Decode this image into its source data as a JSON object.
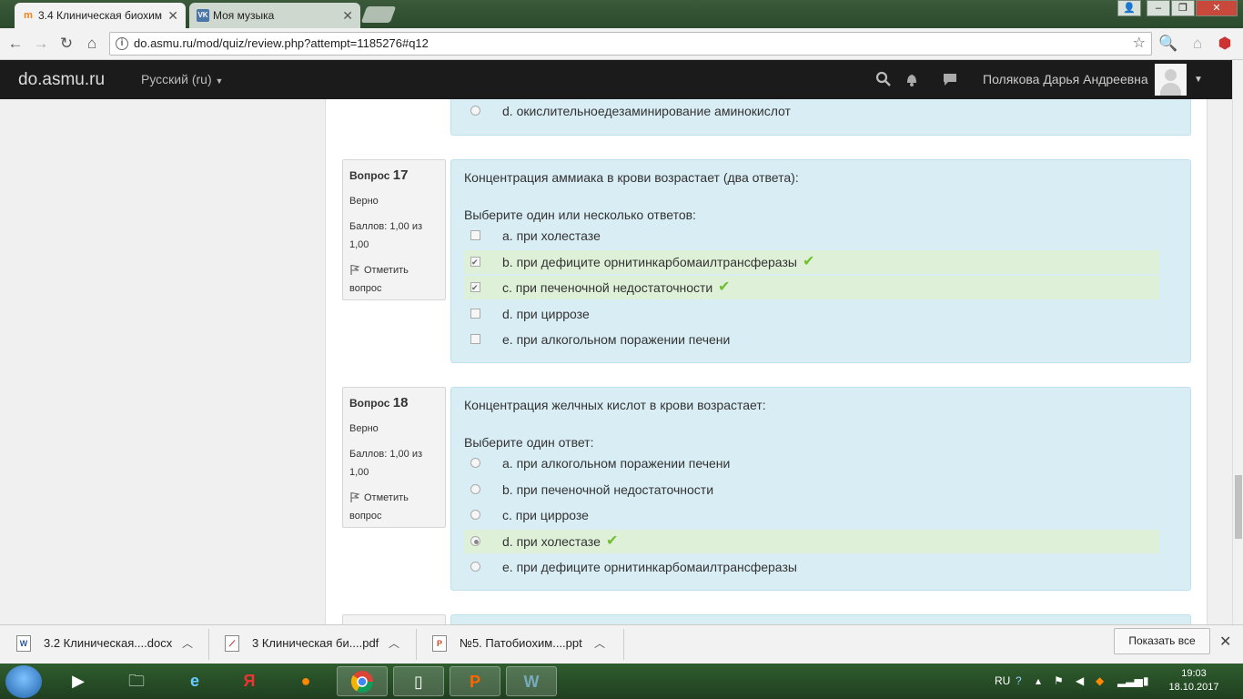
{
  "browser": {
    "tabs": [
      {
        "title": "3.4 Клиническая биохим",
        "active": true
      },
      {
        "title": "Моя музыка",
        "active": false
      }
    ],
    "url": "do.asmu.ru/mod/quiz/review.php?attempt=1185276#q12"
  },
  "navbar": {
    "brand": "do.asmu.ru",
    "language": "Русский ‎(ru)‎",
    "user_name": "Полякова Дарья Андреевна"
  },
  "prev_question": {
    "last_answer": "d. окислительноедезаминирование аминокислот"
  },
  "questions": [
    {
      "label": "Вопрос",
      "number": "17",
      "state": "Верно",
      "grade_line1": "Баллов: 1,00 из",
      "grade_line2": "1,00",
      "flag_line1": "Отметить",
      "flag_line2": "вопрос",
      "text": "Концентрация аммиака в крови возрастает (два ответа):",
      "prompt": "Выберите один или несколько ответов:",
      "answers": [
        {
          "text": "a. при холестазе",
          "checked": false,
          "correct": false
        },
        {
          "text": "b. при дефиците орнитинкарбомаилтрансферазы",
          "checked": true,
          "correct": true
        },
        {
          "text": "c. при печеночной недостаточности",
          "checked": true,
          "correct": true
        },
        {
          "text": "d. при циррозе",
          "checked": false,
          "correct": false
        },
        {
          "text": "e. при алкогольном поражении печени",
          "checked": false,
          "correct": false
        }
      ]
    },
    {
      "label": "Вопрос",
      "number": "18",
      "state": "Верно",
      "grade_line1": "Баллов: 1,00 из",
      "grade_line2": "1,00",
      "flag_line1": "Отметить",
      "flag_line2": "вопрос",
      "text": "Концентрация желчных кислот в крови возрастает:",
      "prompt": "Выберите один ответ:",
      "answers": [
        {
          "text": "a. при алкогольном поражении печени",
          "checked": false,
          "correct": false
        },
        {
          "text": "b. при печеночной недостаточности",
          "checked": false,
          "correct": false
        },
        {
          "text": "c. при циррозе",
          "checked": false,
          "correct": false
        },
        {
          "text": "d. при холестазе",
          "checked": true,
          "correct": true
        },
        {
          "text": "e. при дефиците орнитинкарбомаилтрансферазы",
          "checked": false,
          "correct": false
        }
      ]
    }
  ],
  "downloads": {
    "items": [
      "3.2 Клиническая....docx",
      "3 Клиническая би....pdf",
      "№5. Патобиохим....ppt"
    ],
    "show_all": "Показать все"
  },
  "taskbar": {
    "lang": "RU",
    "time": "19:03",
    "date": "18.10.2017"
  },
  "colors": {
    "navbar": "#1b1b1b",
    "question_bg": "#d9edf5",
    "correct_bg": "#dff0d8",
    "tick": "#6fbf2f"
  }
}
